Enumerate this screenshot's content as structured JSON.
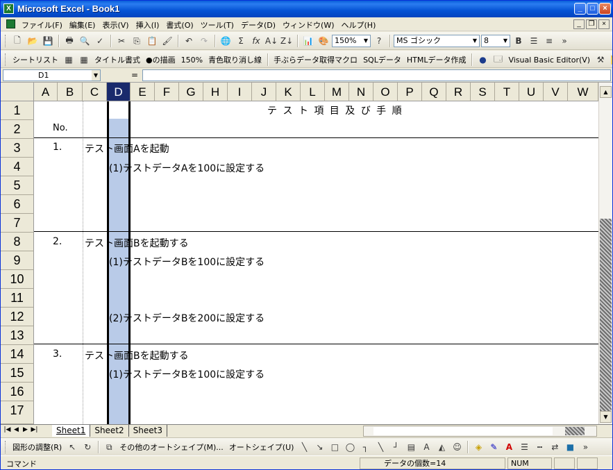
{
  "window": {
    "title": "Microsoft Excel - Book1",
    "minimize": "_",
    "maximize": "□",
    "close": "×"
  },
  "menu": [
    "ファイル(F)",
    "編集(E)",
    "表示(V)",
    "挿入(I)",
    "書式(O)",
    "ツール(T)",
    "データ(D)",
    "ウィンドウ(W)",
    "ヘルプ(H)"
  ],
  "toolbar1": {
    "zoom": "150%",
    "font": "MS ゴシック",
    "font_size": "8",
    "bold": "B"
  },
  "toolbar2": {
    "items": [
      "シートリスト",
      "タイトル書式",
      "●の描画",
      "150%",
      "青色取り消し線",
      "手ぶらデータ取得マクロ",
      "SQLデータ",
      "HTMLデータ作成"
    ],
    "vbe": "Visual Basic Editor(V)"
  },
  "formula": {
    "name_box": "D1",
    "equals": "=",
    "value": ""
  },
  "columns": [
    "A",
    "B",
    "C",
    "D",
    "E",
    "F",
    "G",
    "H",
    "I",
    "J",
    "K",
    "L",
    "M",
    "N",
    "O",
    "P",
    "Q",
    "R",
    "S",
    "T",
    "U",
    "V",
    "W"
  ],
  "selected_column": "D",
  "rows": [
    "1",
    "2",
    "3",
    "4",
    "5",
    "6",
    "7",
    "8",
    "9",
    "10",
    "11",
    "12",
    "13",
    "14",
    "15",
    "16",
    "17"
  ],
  "cells": {
    "title": "テ ス ト 項 目 及 び 手 順",
    "no_header": "No.",
    "n1": "1.",
    "step1": "テスト画面Aを起動",
    "step1_1": "(1)テストデータAを100に設定する",
    "n2": "2.",
    "step2": "テスト画面Bを起動する",
    "step2_1": "(1)テストデータBを100に設定する",
    "step2_2": "(2)テストデータBを200に設定する",
    "n3": "3.",
    "step3": "テスト画面Bを起動する",
    "step3_1": "(1)テストデータBを100に設定する"
  },
  "sheets": [
    "Sheet1",
    "Sheet2",
    "Sheet3"
  ],
  "drawing": {
    "adjust": "図形の調整(R)",
    "other_shapes": "その他のオートシェイプ(M)...",
    "autoshape": "オートシェイプ(U)"
  },
  "status": {
    "mode": "コマンド",
    "count": "データの個数=14",
    "num": "NUM"
  },
  "colors": {
    "title_bar": "#0553d4",
    "selection": "#b9cbe8",
    "header_selected": "#1a2a6c"
  }
}
